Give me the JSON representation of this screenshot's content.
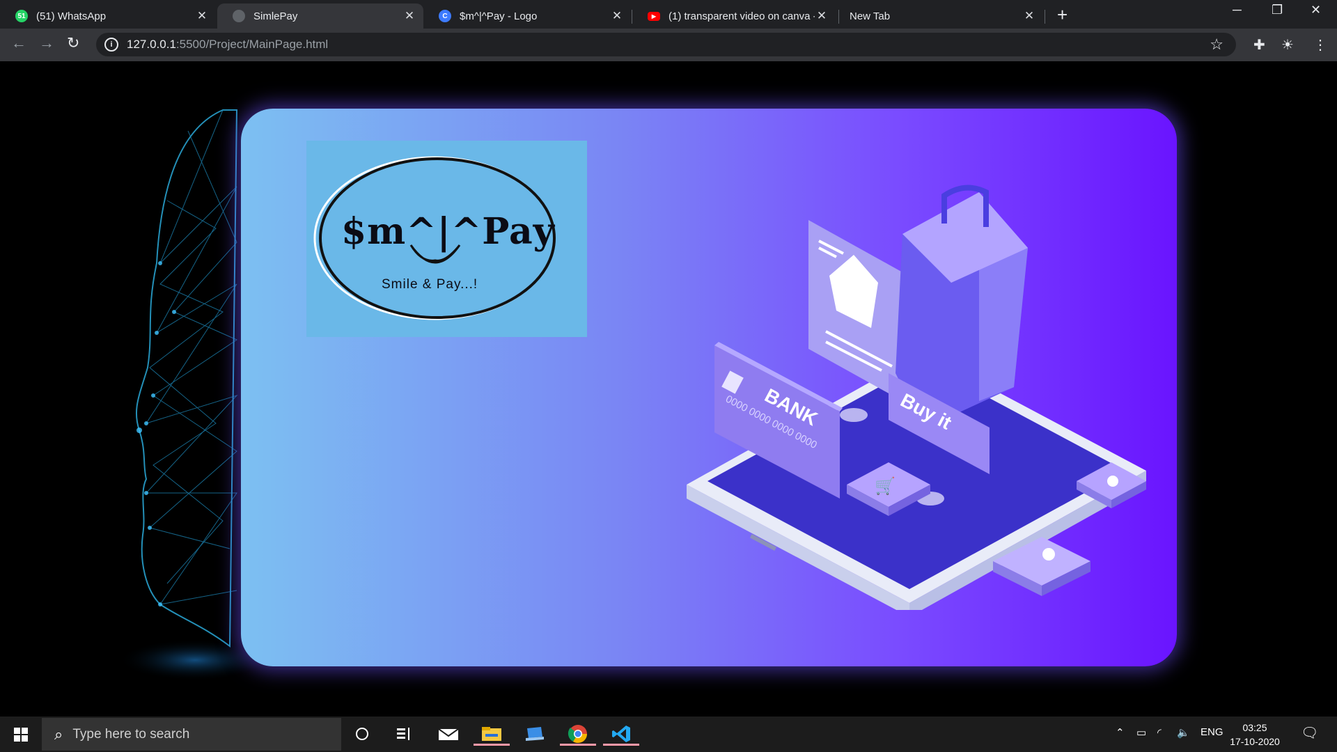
{
  "browser": {
    "tabs": [
      {
        "title": "(51) WhatsApp",
        "icon": "whatsapp-icon",
        "badge": "51",
        "active": false
      },
      {
        "title": "SimlePay",
        "icon": "globe-icon",
        "active": true
      },
      {
        "title": "$m^|^Pay - Logo",
        "icon": "canva-icon",
        "badge": "C",
        "active": false
      },
      {
        "title": "(1) transparent video on canva - ",
        "icon": "youtube-icon",
        "active": false
      },
      {
        "title": "New Tab",
        "icon": "",
        "active": false
      }
    ],
    "new_tab_label": "+",
    "url_host": "127.0.0.1",
    "url_path": ":5500/Project/MainPage.html"
  },
  "page": {
    "logo": {
      "brand_text": "$m^|^Pay",
      "tagline": "Smile & Pay...!"
    },
    "illustration": {
      "card_label": "BANK",
      "card_number": "0000 0000 0000 0000",
      "tag_label": "Buy it"
    },
    "colors": {
      "card_gradient_start": "#7cc0f2",
      "card_gradient_end": "#6a14ff",
      "logo_bg": "#6ab8e8"
    }
  },
  "taskbar": {
    "search_placeholder": "Type here to search",
    "language": "ENG",
    "time": "03:25",
    "date": "17-10-2020"
  }
}
